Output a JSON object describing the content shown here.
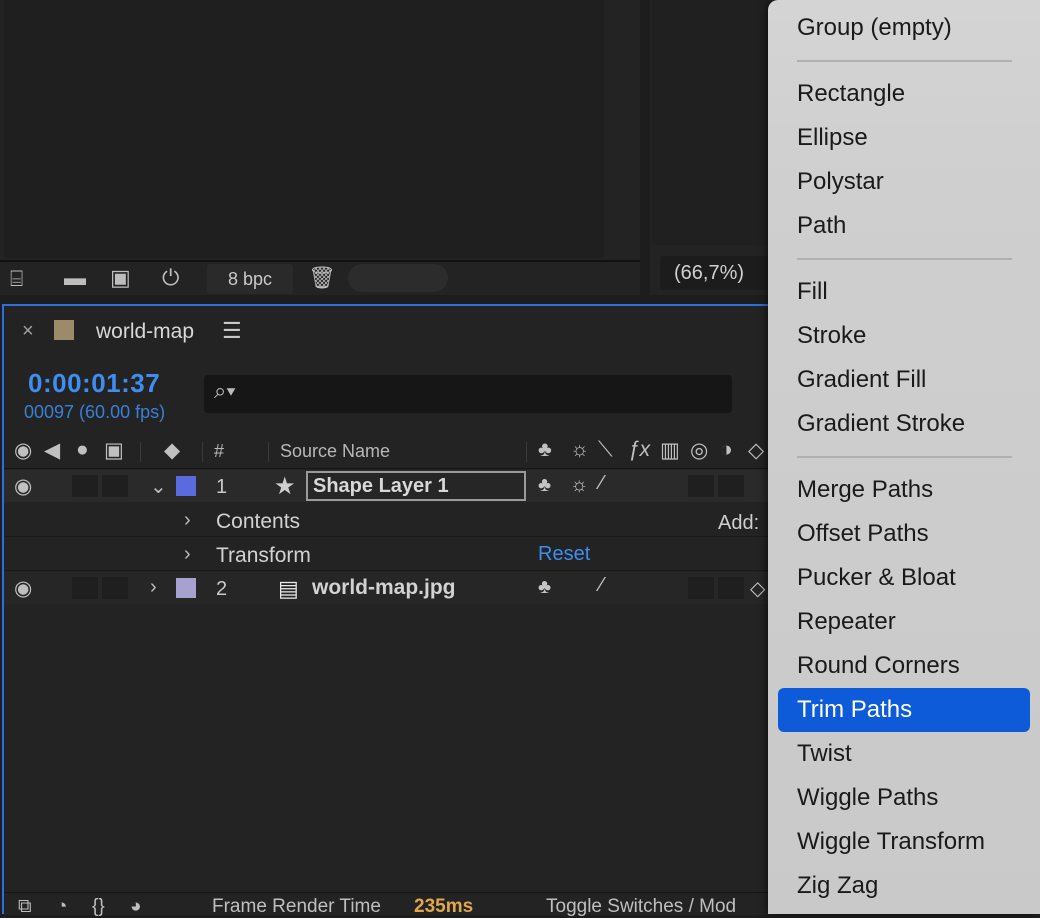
{
  "project_panel": {
    "bpc_label": "8 bpc",
    "icons": [
      "interpret-footage-icon",
      "folder-icon",
      "composition-icon",
      "flowchart-icon",
      "trash-icon"
    ]
  },
  "composition_panel": {
    "zoom": "(66,7%)"
  },
  "timeline": {
    "close_label": "×",
    "title": "world-map",
    "menu_glyph": "☰",
    "timecode": "0:00:01:37",
    "frames": "00097 (60.00 fps)",
    "search_placeholder": "",
    "columns": {
      "number": "#",
      "source_name": "Source Name"
    },
    "layers": [
      {
        "index": "1",
        "name": "Shape Layer 1",
        "label_color": "#5a6be0",
        "expanded": true,
        "children": [
          "Contents",
          "Transform"
        ]
      },
      {
        "index": "2",
        "name": "world-map.jpg",
        "label_color": "#a7a1cf",
        "expanded": false
      }
    ],
    "add_label": "Add:",
    "reset_label": "Reset",
    "footer": {
      "render_time_label": "Frame Render Time",
      "render_time_value": "235ms",
      "toggle_label": "Toggle Switches / Mod"
    }
  },
  "context_menu": {
    "groups": [
      [
        "Group (empty)"
      ],
      [
        "Rectangle",
        "Ellipse",
        "Polystar",
        "Path"
      ],
      [
        "Fill",
        "Stroke",
        "Gradient Fill",
        "Gradient Stroke"
      ],
      [
        "Merge Paths",
        "Offset Paths",
        "Pucker & Bloat",
        "Repeater",
        "Round Corners",
        "Trim Paths",
        "Twist",
        "Wiggle Paths",
        "Wiggle Transform",
        "Zig Zag"
      ]
    ],
    "highlighted": "Trim Paths",
    "highlight_color": "#0d5bd9"
  }
}
